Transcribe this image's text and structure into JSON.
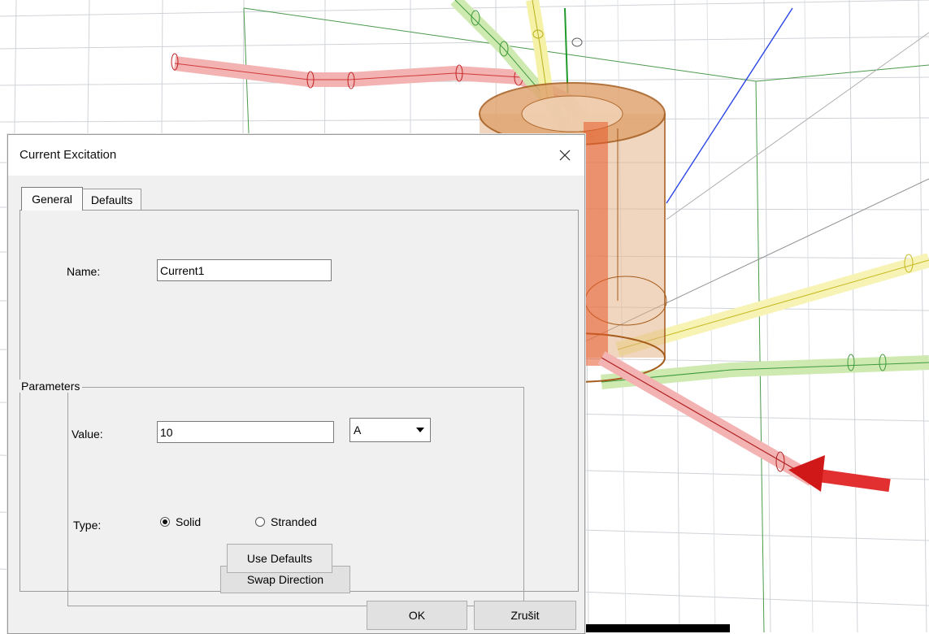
{
  "dialog": {
    "title": "Current Excitation",
    "tabs": [
      {
        "label": "General"
      },
      {
        "label": "Defaults"
      }
    ],
    "name_label": "Name:",
    "name_value": "Current1",
    "parameters": {
      "legend": "Parameters",
      "value_label": "Value:",
      "value": "10",
      "unit_selected": "A",
      "type_label": "Type:",
      "type_options": [
        "Solid",
        "Stranded"
      ],
      "type_selected": "Solid",
      "swap_label": "Swap Direction"
    },
    "use_defaults_label": "Use Defaults",
    "ok_label": "OK",
    "cancel_label": "Zrušit"
  },
  "icons": {
    "close": "close-icon",
    "dropdown": "chevron-down-icon"
  },
  "colors": {
    "conductor_red": "#e23b3b",
    "conductor_green": "#4aa84a",
    "conductor_yellow": "#e6e04a",
    "core": "#d88a3c",
    "axis_blue": "#2a45e6",
    "grid": "#c8ccd2"
  }
}
